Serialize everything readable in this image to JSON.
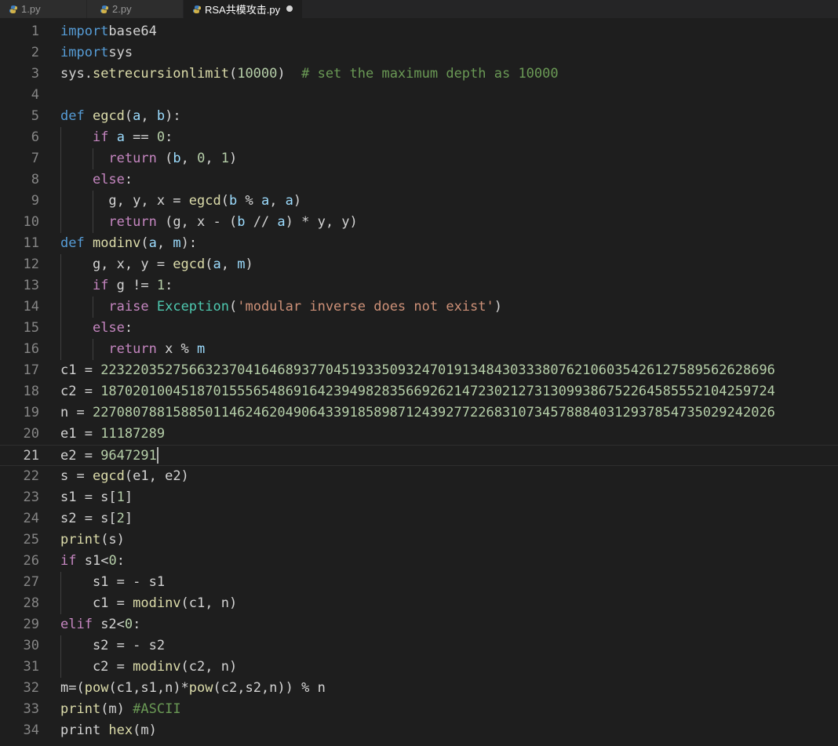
{
  "tabs": [
    {
      "label": "1.py",
      "active": false
    },
    {
      "label": "2.py",
      "active": false
    },
    {
      "label": "RSA共模攻击.py",
      "active": true,
      "unsaved": true
    }
  ],
  "editor": {
    "current_line": 21,
    "lines": [
      [
        [
          "kd",
          "import"
        ],
        [
          "",
          "base64"
        ]
      ],
      [
        [
          "kd",
          "import"
        ],
        [
          "",
          "sys"
        ]
      ],
      [
        [
          "",
          "sys."
        ],
        [
          "f",
          "setrecursionlimit"
        ],
        [
          "",
          "("
        ],
        [
          "n",
          "10000"
        ],
        [
          "",
          ")  "
        ],
        [
          "c",
          "# set the maximum depth as 10000"
        ]
      ],
      [],
      [
        [
          "kd",
          "def"
        ],
        [
          "",
          ""
        ],
        [
          "f",
          "egcd"
        ],
        [
          "",
          "("
        ],
        [
          "v",
          "a"
        ],
        [
          "",
          ", "
        ],
        [
          "v",
          "b"
        ],
        [
          "",
          "):"
        ]
      ],
      [
        [
          "",
          "    "
        ],
        [
          "k",
          "if"
        ],
        [
          "",
          ""
        ],
        [
          "v",
          "a"
        ],
        [
          "",
          " == "
        ],
        [
          "n",
          "0"
        ],
        [
          "",
          ":"
        ]
      ],
      [
        [
          "",
          "      "
        ],
        [
          "k",
          "return"
        ],
        [
          "",
          " ("
        ],
        [
          "v",
          "b"
        ],
        [
          "",
          ", "
        ],
        [
          "n",
          "0"
        ],
        [
          "",
          ", "
        ],
        [
          "n",
          "1"
        ],
        [
          "",
          ")"
        ]
      ],
      [
        [
          "",
          "    "
        ],
        [
          "k",
          "else"
        ],
        [
          "",
          ":"
        ]
      ],
      [
        [
          "",
          "      g, y, x = "
        ],
        [
          "f",
          "egcd"
        ],
        [
          "",
          "("
        ],
        [
          "v",
          "b"
        ],
        [
          "",
          " % "
        ],
        [
          "v",
          "a"
        ],
        [
          "",
          ", "
        ],
        [
          "v",
          "a"
        ],
        [
          "",
          ")"
        ]
      ],
      [
        [
          "",
          "      "
        ],
        [
          "k",
          "return"
        ],
        [
          "",
          " (g, x - ("
        ],
        [
          "v",
          "b"
        ],
        [
          "",
          " // "
        ],
        [
          "v",
          "a"
        ],
        [
          "",
          ") * y, y)"
        ]
      ],
      [
        [
          "kd",
          "def"
        ],
        [
          "",
          ""
        ],
        [
          "f",
          "modinv"
        ],
        [
          "",
          "("
        ],
        [
          "v",
          "a"
        ],
        [
          "",
          ", "
        ],
        [
          "v",
          "m"
        ],
        [
          "",
          "):"
        ]
      ],
      [
        [
          "",
          "    g, x, y = "
        ],
        [
          "f",
          "egcd"
        ],
        [
          "",
          "("
        ],
        [
          "v",
          "a"
        ],
        [
          "",
          ", "
        ],
        [
          "v",
          "m"
        ],
        [
          "",
          ")"
        ]
      ],
      [
        [
          "",
          "    "
        ],
        [
          "k",
          "if"
        ],
        [
          "",
          " g != "
        ],
        [
          "n",
          "1"
        ],
        [
          "",
          ":"
        ]
      ],
      [
        [
          "",
          "      "
        ],
        [
          "k",
          "raise"
        ],
        [
          "",
          ""
        ],
        [
          "cls",
          "Exception"
        ],
        [
          "",
          "("
        ],
        [
          "s",
          "'modular inverse does not exist'"
        ],
        [
          "",
          ")"
        ]
      ],
      [
        [
          "",
          "    "
        ],
        [
          "k",
          "else"
        ],
        [
          "",
          ":"
        ]
      ],
      [
        [
          "",
          "      "
        ],
        [
          "k",
          "return"
        ],
        [
          "",
          " x % "
        ],
        [
          "v",
          "m"
        ]
      ],
      [
        [
          "",
          "c1 = "
        ],
        [
          "n",
          "223220352756632370416468937704519335093247019134843033380762106035426127589562628696"
        ]
      ],
      [
        [
          "",
          "c2 = "
        ],
        [
          "n",
          "187020100451870155565486916423949828356692621472302127313099386752264585552104259724"
        ]
      ],
      [
        [
          "",
          "n = "
        ],
        [
          "n",
          "2270807881588501146246204906433918589871243927722683107345788840312937854735029242026"
        ]
      ],
      [
        [
          "",
          "e1 = "
        ],
        [
          "n",
          "11187289"
        ]
      ],
      [
        [
          "",
          "e2 = "
        ],
        [
          "n",
          "9647291"
        ]
      ],
      [
        [
          "",
          "s = "
        ],
        [
          "f",
          "egcd"
        ],
        [
          "",
          "(e1, e2)"
        ]
      ],
      [
        [
          "",
          "s1 = s["
        ],
        [
          "n",
          "1"
        ],
        [
          "",
          "]"
        ]
      ],
      [
        [
          "",
          "s2 = s["
        ],
        [
          "n",
          "2"
        ],
        [
          "",
          "]"
        ]
      ],
      [
        [
          "f",
          "print"
        ],
        [
          "",
          "(s)"
        ]
      ],
      [
        [
          "k",
          "if"
        ],
        [
          "",
          " s1<"
        ],
        [
          "n",
          "0"
        ],
        [
          "",
          ":"
        ]
      ],
      [
        [
          "",
          "    s1 = - s1"
        ]
      ],
      [
        [
          "",
          "    c1 = "
        ],
        [
          "f",
          "modinv"
        ],
        [
          "",
          "(c1, n)"
        ]
      ],
      [
        [
          "k",
          "elif"
        ],
        [
          "",
          " s2<"
        ],
        [
          "n",
          "0"
        ],
        [
          "",
          ":"
        ]
      ],
      [
        [
          "",
          "    s2 = - s2"
        ]
      ],
      [
        [
          "",
          "    c2 = "
        ],
        [
          "f",
          "modinv"
        ],
        [
          "",
          "(c2, n)"
        ]
      ],
      [
        [
          "",
          "m=("
        ],
        [
          "f",
          "pow"
        ],
        [
          "",
          "(c1,s1,n)*"
        ],
        [
          "f",
          "pow"
        ],
        [
          "",
          "(c2,s2,n)) % n"
        ]
      ],
      [
        [
          "f",
          "print"
        ],
        [
          "",
          "(m) "
        ],
        [
          "c",
          "#ASCII"
        ]
      ],
      [
        [
          "",
          "print "
        ],
        [
          "f",
          "hex"
        ],
        [
          "",
          "(m)"
        ]
      ]
    ]
  }
}
